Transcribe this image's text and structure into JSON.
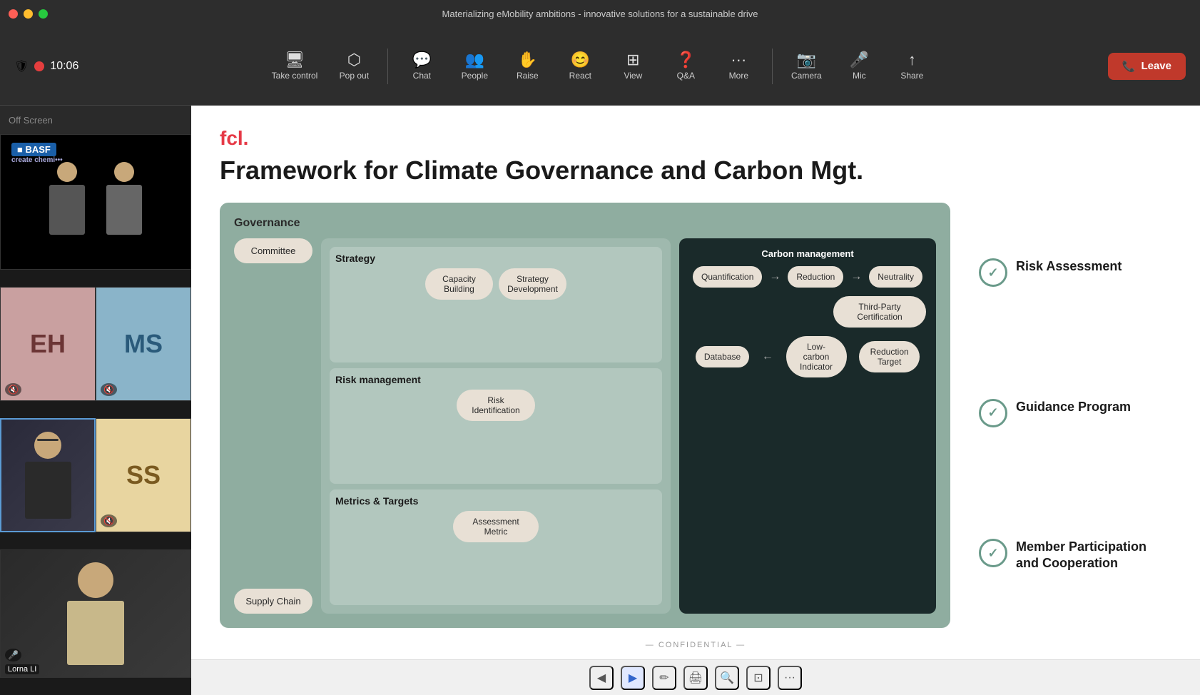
{
  "window": {
    "title": "Materializing eMobility ambitions - innovative solutions for a sustainable drive"
  },
  "toolbar": {
    "time": "10:06",
    "items": [
      {
        "id": "take-control",
        "label": "Take control",
        "icon": "🖥"
      },
      {
        "id": "pop-out",
        "label": "Pop out",
        "icon": "⬡"
      },
      {
        "id": "chat",
        "label": "Chat",
        "icon": "💬"
      },
      {
        "id": "people",
        "label": "People",
        "icon": "👥"
      },
      {
        "id": "raise",
        "label": "Raise",
        "icon": "✋"
      },
      {
        "id": "react",
        "label": "React",
        "icon": "😊"
      },
      {
        "id": "view",
        "label": "View",
        "icon": "⊞"
      },
      {
        "id": "qa",
        "label": "Q&A",
        "icon": "❓"
      },
      {
        "id": "more",
        "label": "More",
        "icon": "•••"
      },
      {
        "id": "camera",
        "label": "Camera",
        "icon": "📷"
      },
      {
        "id": "mic",
        "label": "Mic",
        "icon": "🎤"
      },
      {
        "id": "share",
        "label": "Share",
        "icon": "↑"
      }
    ],
    "leave_label": "Leave"
  },
  "sidebar": {
    "header": "Off Screen",
    "participants": [
      {
        "id": "basf-video",
        "type": "video",
        "name": ""
      },
      {
        "id": "eh",
        "type": "avatar",
        "initials": "EH",
        "style": "eh",
        "muted": true
      },
      {
        "id": "ms",
        "type": "avatar",
        "initials": "MS",
        "style": "ms",
        "muted": true
      },
      {
        "id": "active-video",
        "type": "video",
        "name": "",
        "active": true
      },
      {
        "id": "ss",
        "type": "avatar",
        "initials": "SS",
        "style": "ss",
        "muted": true
      },
      {
        "id": "lorna-video",
        "type": "video",
        "name": "Lorna LI"
      }
    ]
  },
  "slide": {
    "logo": "fcl.",
    "title": "Framework for Climate Governance and Carbon Mgt.",
    "governance_label": "Governance",
    "strategy_label": "Strategy",
    "risk_label": "Risk management",
    "metrics_label": "Metrics & Targets",
    "carbon_label": "Carbon management",
    "nodes": {
      "committee": "Committee",
      "supply_chain": "Supply Chain",
      "capacity_building": "Capacity Building",
      "strategy_dev": "Strategy Development",
      "risk_id": "Risk Identification",
      "assessment_metric": "Assessment Metric",
      "quantification": "Quantification",
      "reduction": "Reduction",
      "neutrality": "Neutrality",
      "third_party": "Third-Party Certification",
      "database": "Database",
      "low_carbon": "Low-carbon Indicator",
      "reduction_target": "Reduction Target"
    },
    "checklist": [
      {
        "id": "risk",
        "label": "Risk Assessment"
      },
      {
        "id": "guidance",
        "label": "Guidance Program"
      },
      {
        "id": "member",
        "label": "Member Participation and Cooperation"
      }
    ],
    "confidential": "— CONFIDENTIAL —"
  },
  "slide_toolbar": {
    "buttons": [
      "◀",
      "▶",
      "✏",
      "🖨",
      "🔍",
      "⊡",
      "•••"
    ]
  }
}
